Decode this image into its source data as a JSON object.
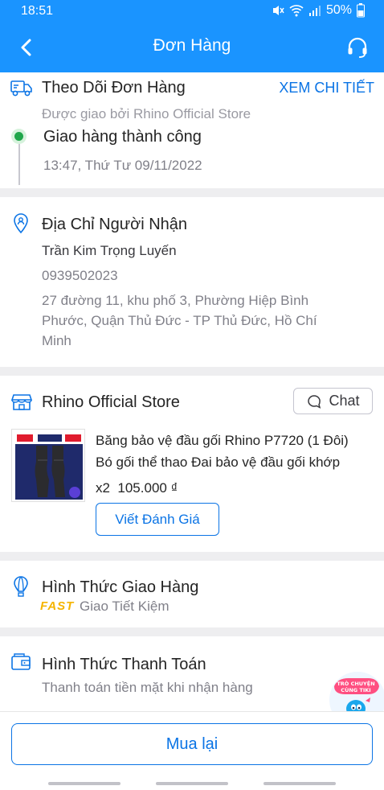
{
  "status_bar": {
    "time": "18:51",
    "battery": "50%"
  },
  "header": {
    "title": "Đơn Hàng"
  },
  "tracking": {
    "title": "Theo Dõi Đơn Hàng",
    "detail_link": "XEM CHI TIẾT",
    "delivered_by": "Được giao bởi Rhino Official Store",
    "status": "Giao hàng thành công",
    "timestamp": "13:47, Thứ Tư 09/11/2022",
    "status_color": "#1fa64a"
  },
  "address": {
    "title": "Địa Chỉ Người Nhận",
    "name": "Trần Kim Trọng Luyến",
    "phone": "0939502023",
    "line1": "27 đường 11, khu phố 3, Phường Hiệp Bình",
    "line2": "Phước, Quận Thủ Đức - TP Thủ Đức, Hồ Chí",
    "line3": "Minh"
  },
  "store": {
    "name": "Rhino Official Store",
    "chat_label": "Chat",
    "product": {
      "title_line1": "Băng bảo vệ đầu gối Rhino P7720 (1 Đôi)",
      "title_line2": "Bó gối thể thao Đai bảo vệ đầu gối khớp",
      "quantity_price": "x2  105.000 ₫",
      "image_badge_left": "TAIHAI",
      "image_badge_right": "50%"
    },
    "review_button": "Viết Đánh Giá"
  },
  "shipping": {
    "title": "Hình Thức Giao Hàng",
    "badge": "FAST",
    "method": "Giao Tiết Kiệm",
    "badge_color": "#f5b400"
  },
  "payment": {
    "title": "Hình Thức Thanh Toán",
    "method": "Thanh toán tiền mặt khi nhận hàng"
  },
  "chat_bubble": {
    "line1": "TRÒ CHUYỆN",
    "line2": "CÙNG TIKI"
  },
  "footer": {
    "rebuy_button": "Mua lại"
  },
  "colors": {
    "brand_blue": "#1a94ff",
    "link_blue": "#0b74e5"
  }
}
